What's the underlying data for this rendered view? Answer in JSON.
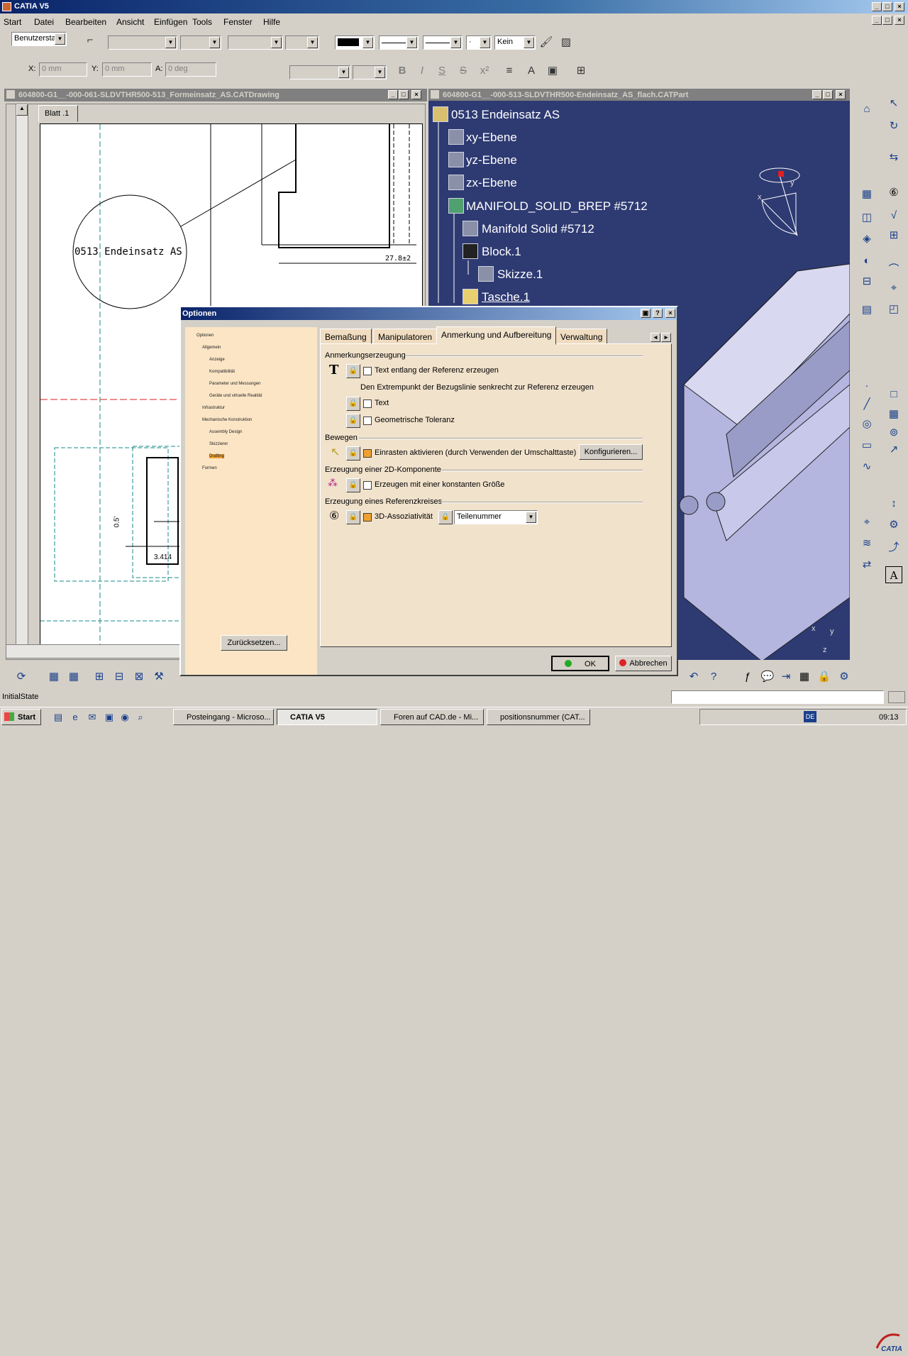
{
  "app": {
    "title": "CATIA V5"
  },
  "menu": [
    "Start",
    "Datei",
    "Bearbeiten",
    "Ansicht",
    "Einfügen",
    "Tools",
    "Fenster",
    "Hilfe"
  ],
  "toolbar": {
    "style_select": "Benutzersta",
    "line_weight": "Kein",
    "x_label": "X:",
    "y_label": "Y:",
    "a_label": "A:",
    "x_value": "0 mm",
    "y_value": "0 mm",
    "a_value": "0 deg",
    "font_buttons": [
      "B",
      "I",
      "S",
      "S",
      "x²"
    ]
  },
  "drawing_window": {
    "title": "604800-G1__-000-061-SLDVTHR500-513_Formeinsatz_AS.CATDrawing",
    "sheet_tab": "Blatt .1",
    "balloon_text": "0513 Endeinsatz AS",
    "dim_1": "27.8±2",
    "dim_2": "0.5'",
    "dim_3": "3.414"
  },
  "part_window": {
    "title": "604800-G1__-000-513-SLDVTHR500-Endeinsatz_AS_flach.CATPart",
    "tree": [
      {
        "label": "0513 Endeinsatz AS",
        "icon": "part-icon"
      },
      {
        "label": "xy-Ebene",
        "icon": "plane-icon"
      },
      {
        "label": "yz-Ebene",
        "icon": "plane-icon"
      },
      {
        "label": "zx-Ebene",
        "icon": "plane-icon"
      },
      {
        "label": "MANIFOLD_SOLID_BREP #5712",
        "icon": "gear-icon"
      },
      {
        "label": "Manifold Solid #5712",
        "icon": "solid-icon"
      },
      {
        "label": "Block.1",
        "icon": "block-icon"
      },
      {
        "label": "Skizze.1",
        "icon": "sketch-icon"
      },
      {
        "label": "Tasche.1",
        "icon": "pocket-icon"
      }
    ],
    "compass_labels": {
      "x": "x",
      "y": "y",
      "z": "z"
    }
  },
  "dialog": {
    "title": "Optionen",
    "tree": [
      "Optionen",
      "Allgemein",
      "Anzeige",
      "Kompatibilität",
      "Parameter und Messungen",
      "Geräte und virtuelle Realität",
      "Infrastruktur",
      "Mechanische Konstruktion",
      "Assembly Design",
      "Skizzierer",
      "Drafting",
      "Formen"
    ],
    "tabs": [
      "Bemaßung",
      "Manipulatoren",
      "Anmerkung und Aufbereitung",
      "Verwaltung"
    ],
    "active_tab": 2,
    "sections": {
      "creation": "Anmerkungserzeugung",
      "text_along_ref": "Text entlang der Referenz erzeugen",
      "extremity_note": "Den Extrempunkt der Bezugslinie senkrecht zur Referenz erzeugen",
      "text": "Text",
      "geo_tol": "Geometrische Toleranz",
      "move": "Bewegen",
      "snap": "Einrasten aktivieren (durch Verwenden der Umschalttaste)",
      "configure": "Konfigurieren...",
      "comp2d": "Erzeugung einer 2D-Komponente",
      "const_size": "Erzeugen mit einer konstanten Größe",
      "refcircle": "Erzeugung eines Referenzkreises",
      "assoc3d": "3D-Assoziativität",
      "assoc_value": "Teilenummer"
    },
    "reset": "Zurücksetzen...",
    "ok": "OK",
    "cancel": "Abbrechen"
  },
  "status": {
    "text": "InitialState"
  },
  "taskbar": {
    "start": "Start",
    "tasks": [
      "Posteingang - Microso...",
      "CATIA V5",
      "Foren auf CAD.de - Mi...",
      "positionsnummer (CAT..."
    ],
    "clock": "09:13",
    "lang": "DE"
  },
  "colors": {
    "title_blue": "#0a246a",
    "viewport": "#2e3a72",
    "dialog_panel": "#f1e2cc",
    "tree_bg": "#fbe5c5"
  }
}
